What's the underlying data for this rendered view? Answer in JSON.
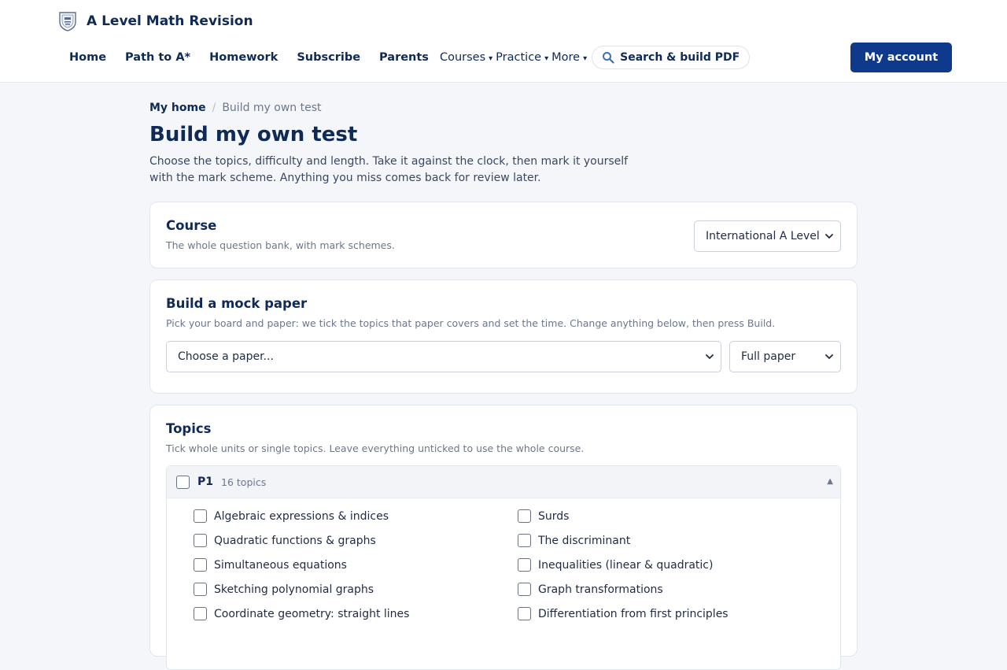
{
  "header": {
    "brand": "A Level Math Revision",
    "nav": {
      "home": "Home",
      "path": "Path to A*",
      "homework": "Homework",
      "subscribe": "Subscribe",
      "parents": "Parents",
      "courses": "Courses",
      "practice": "Practice",
      "more": "More",
      "search": "Search & build PDF"
    },
    "account": "My account"
  },
  "breadcrumb": {
    "home": "My home",
    "separator": "/",
    "current": "Build my own test"
  },
  "page": {
    "title": "Build my own test",
    "intro": "Choose the topics, difficulty and length. Take it against the clock, then mark it yourself with the mark scheme. Anything you miss comes back for review later."
  },
  "course": {
    "title": "Course",
    "subtitle": "The whole question bank, with mark schemes.",
    "selected": "International A Level"
  },
  "mock": {
    "title": "Build a mock paper",
    "subtitle": "Pick your board and paper: we tick the topics that paper covers and set the time. Change anything below, then press Build.",
    "paper_placeholder": "Choose a paper...",
    "length": "Full paper"
  },
  "topics": {
    "title": "Topics",
    "subtitle": "Tick whole units or single topics. Leave everything unticked to use the whole course.",
    "unit": {
      "name": "P1",
      "count": "16 topics",
      "items": [
        "Algebraic expressions & indices",
        "Surds",
        "Quadratic functions & graphs",
        "The discriminant",
        "Simultaneous equations",
        "Inequalities (linear & quadratic)",
        "Sketching polynomial graphs",
        "Graph transformations",
        "Coordinate geometry: straight lines",
        "Differentiation from first principles"
      ]
    }
  },
  "colors": {
    "brand_navy": "#0f2a57",
    "button_blue": "#0f3a8c",
    "page_bg": "#f4f6fa"
  }
}
